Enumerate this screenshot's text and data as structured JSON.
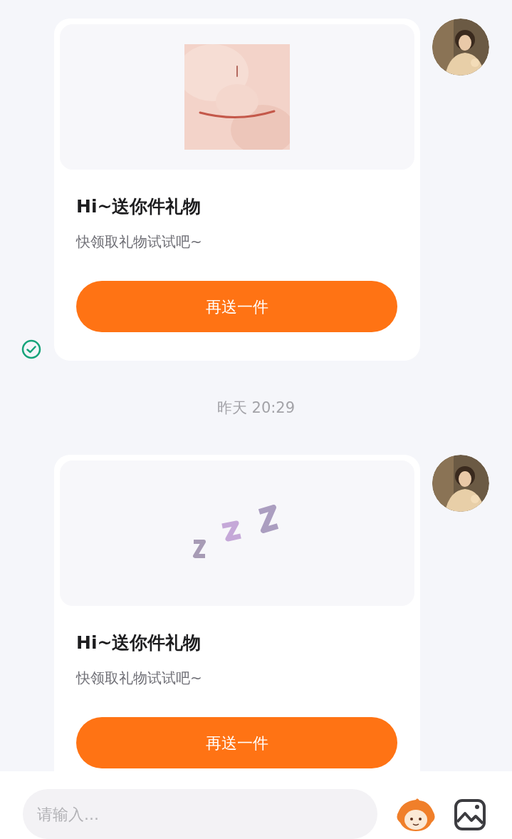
{
  "messages": [
    {
      "kind": "gift",
      "title": "Hi~送你件礼物",
      "subtitle": "快领取礼物试试吧~",
      "button": "再送一件",
      "delivered": true
    },
    {
      "kind": "timestamp",
      "text": "昨天 20:29"
    },
    {
      "kind": "gift",
      "gift": {
        "kind": "sleep"
      },
      "title": "Hi~送你件礼物",
      "subtitle": "快领取礼物试试吧~",
      "button": "再送一件"
    }
  ],
  "composer": {
    "placeholder": "请输入..."
  }
}
